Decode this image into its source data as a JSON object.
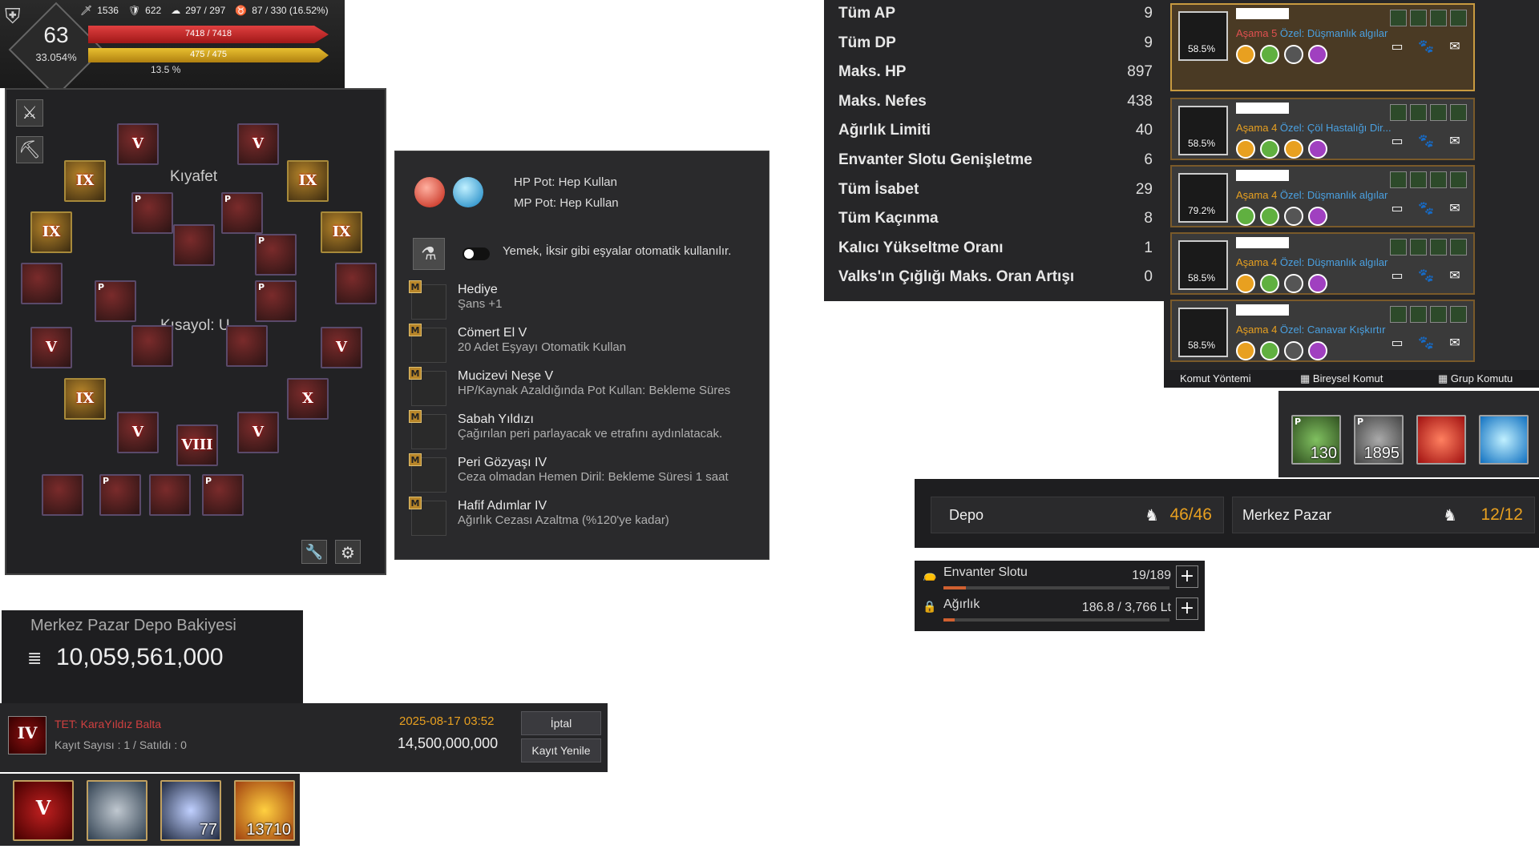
{
  "hud": {
    "level": "63",
    "level_pct": "33.054%",
    "ap": "1536",
    "dp": "622",
    "energy": "297 / 297",
    "contrib": "87 / 330 (16.52%)",
    "hp": "7418 / 7418",
    "mp": "475 / 475",
    "xp_pct": "13.5 %",
    "hp_fill": 1.0,
    "mp_fill": 1.0
  },
  "equipment": {
    "outfit_label": "Kıyafet",
    "shortcut_label": "Kısayol: U",
    "slots": [
      {
        "tag": "",
        "lvl": "V"
      },
      {
        "tag": "",
        "lvl": "V"
      },
      {
        "tag": "",
        "lvl": "IX"
      },
      {
        "tag": "",
        "lvl": "IX"
      },
      {
        "tag": "P",
        "lvl": ""
      },
      {
        "tag": "P",
        "lvl": ""
      },
      {
        "tag": "",
        "lvl": "IX"
      },
      {
        "tag": "",
        "lvl": "IX"
      },
      {
        "tag": "",
        "lvl": ""
      },
      {
        "tag": "P",
        "lvl": ""
      },
      {
        "tag": "",
        "lvl": ""
      },
      {
        "tag": "",
        "lvl": ""
      },
      {
        "tag": "P",
        "lvl": ""
      },
      {
        "tag": "P",
        "lvl": ""
      },
      {
        "tag": "",
        "lvl": "V"
      },
      {
        "tag": "",
        "lvl": "V"
      },
      {
        "tag": "",
        "lvl": ""
      },
      {
        "tag": "",
        "lvl": ""
      },
      {
        "tag": "",
        "lvl": "IX"
      },
      {
        "tag": "",
        "lvl": "X"
      },
      {
        "tag": "",
        "lvl": "V"
      },
      {
        "tag": "",
        "lvl": "VIII"
      },
      {
        "tag": "",
        "lvl": "V"
      },
      {
        "tag": "",
        "lvl": ""
      },
      {
        "tag": "P",
        "lvl": ""
      },
      {
        "tag": "",
        "lvl": ""
      },
      {
        "tag": "P",
        "lvl": ""
      }
    ]
  },
  "potions": {
    "hp_label": "HP Pot: Hep Kullan",
    "mp_label": "MP Pot: Hep Kullan",
    "auto_label": "Yemek, İksir gibi eşyalar otomatik kullanılır.",
    "skills": [
      {
        "title": "Hediye",
        "desc": "Şans +1"
      },
      {
        "title": "Cömert El V",
        "desc": "20 Adet Eşyayı Otomatik Kullan"
      },
      {
        "title": "Mucizevi Neşe V",
        "desc": "HP/Kaynak Azaldığında Pot Kullan: Bekleme Süres"
      },
      {
        "title": "Sabah Yıldızı",
        "desc": "Çağırılan peri parlayacak ve etrafını aydınlatacak."
      },
      {
        "title": "Peri Gözyaşı IV",
        "desc": "Ceza olmadan Hemen Diril: Bekleme Süresi 1 saat"
      },
      {
        "title": "Hafif Adımlar IV",
        "desc": "Ağırlık Cezası Azaltma (%120'ye kadar)"
      }
    ]
  },
  "stats": [
    {
      "label": "Tüm AP",
      "value": "9"
    },
    {
      "label": "Tüm DP",
      "value": "9"
    },
    {
      "label": "Maks. HP",
      "value": "897"
    },
    {
      "label": "Maks. Nefes",
      "value": "438"
    },
    {
      "label": "Ağırlık Limiti",
      "value": "40"
    },
    {
      "label": "Envanter Slotu Genişletme",
      "value": "6"
    },
    {
      "label": "Tüm İsabet",
      "value": "29"
    },
    {
      "label": "Tüm Kaçınma",
      "value": "8"
    },
    {
      "label": "Kalıcı Yükseltme Oranı",
      "value": "1"
    },
    {
      "label": "Valks'ın Çığlığı Maks. Oran Artışı",
      "value": "0"
    }
  ],
  "pets": {
    "cards": [
      {
        "pct": "58.5%",
        "stage": "Aşama 5",
        "special": "Özel: Düşmanlık algılar",
        "stage_color": "#e05050"
      },
      {
        "pct": "58.5%",
        "stage": "Aşama 4",
        "special": "Özel: Çöl Hastalığı Dir...",
        "stage_color": "#e8a020"
      },
      {
        "pct": "79.2%",
        "stage": "Aşama 4",
        "special": "Özel: Düşmanlık algılar",
        "stage_color": "#e8a020"
      },
      {
        "pct": "58.5%",
        "stage": "Aşama 4",
        "special": "Özel: Düşmanlık algılar",
        "stage_color": "#e8a020"
      },
      {
        "pct": "58.5%",
        "stage": "Aşama 4",
        "special": "Özel: Canavar Kışkırtır",
        "stage_color": "#e8a020"
      }
    ],
    "footer": {
      "cmd": "Komut Yöntemi",
      "individual": "Bireysel Komut",
      "group": "Grup Komutu"
    }
  },
  "quickslots_right": [
    {
      "tag": "P",
      "qty": "130"
    },
    {
      "tag": "P",
      "qty": "1895"
    },
    {
      "tag": "",
      "qty": ""
    },
    {
      "tag": "",
      "qty": ""
    }
  ],
  "storage": {
    "depot_label": "Depo",
    "depot_value": "46/46",
    "market_label": "Merkez Pazar",
    "market_value": "12/12"
  },
  "inventory": {
    "slot_label": "Envanter Slotu",
    "slot_value": "19/189",
    "weight_label": "Ağırlık",
    "weight_value": "186.8 / 3,766 Lt",
    "slot_fill": 0.1,
    "weight_fill": 0.05
  },
  "market": {
    "balance_title": "Merkez Pazar Depo Bakiyesi",
    "balance": "10,059,561,000",
    "listing_tag": "IV",
    "listing_name": "TET: KaraYıldız Balta",
    "listing_meta": "Kayıt Sayısı : 1 / Satıldı : 0",
    "listing_date": "2025-08-17 03:52",
    "listing_price": "14,500,000,000",
    "cancel_btn": "İptal",
    "renew_btn": "Kayıt Yenile"
  },
  "quickslots_bottom": [
    {
      "lvl": "V",
      "qty": ""
    },
    {
      "lvl": "",
      "qty": ""
    },
    {
      "lvl": "",
      "qty": "77"
    },
    {
      "lvl": "",
      "qty": "13710"
    }
  ]
}
